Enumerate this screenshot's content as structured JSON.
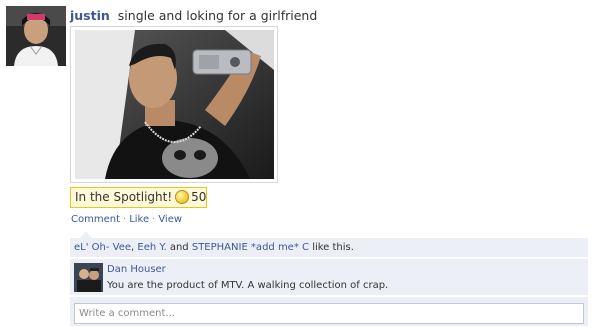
{
  "story": {
    "author": "justin",
    "status": "single and loking for a girlfriend"
  },
  "spotlight": {
    "label": "In the Spotlight!",
    "points": "50",
    "icon": "coin-icon"
  },
  "actions": {
    "comment": "Comment",
    "like": "Like",
    "view": "View",
    "separator": "·"
  },
  "likes": {
    "names": [
      "eL' Oh- Vee",
      "Eeh Y.",
      "STEPHANIE *add me* C"
    ],
    "separator": ", ",
    "and": "and",
    "suffix": "like this."
  },
  "comment": {
    "author": "Dan Houser",
    "text": "You are the product of MTV. A walking collection of crap."
  },
  "comment_box": {
    "placeholder": "Write a comment..."
  },
  "colors": {
    "link": "#3b5998",
    "feedback_bg": "#eceff5",
    "spotlight_bg": "#fff9d7",
    "spotlight_border": "#e2c822"
  }
}
